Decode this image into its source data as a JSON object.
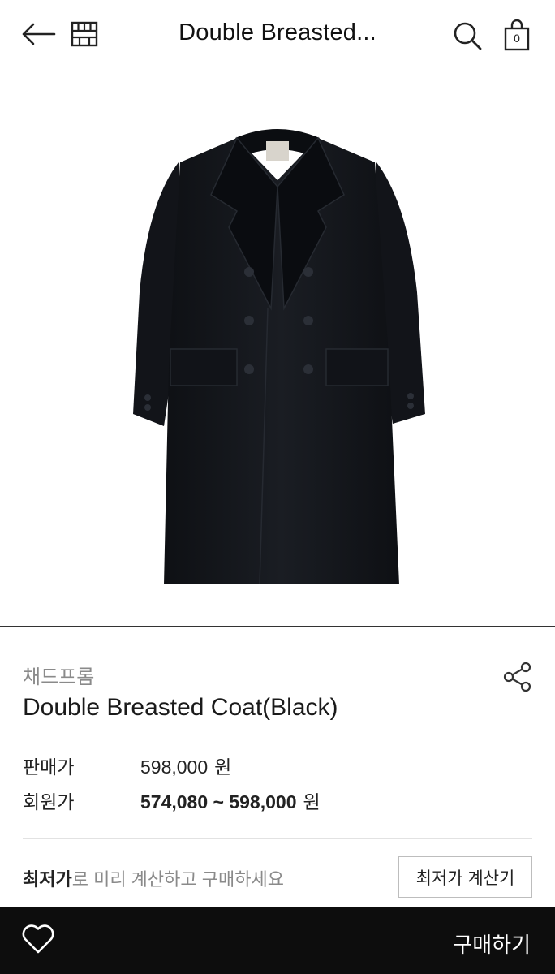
{
  "header": {
    "title": "Double Breasted...",
    "cart_count": "0",
    "icons": [
      "back-arrow-icon",
      "store-icon",
      "search-icon",
      "shopping-bag-icon"
    ]
  },
  "product": {
    "brand": "채드프롬",
    "name": "Double Breasted Coat(Black)",
    "image_desc_icon": "black-double-breasted-coat-image"
  },
  "prices": {
    "sale_label": "판매가",
    "sale_value": "598,000",
    "sale_unit": "원",
    "member_label": "회원가",
    "member_value": "574,080 ~ 598,000",
    "member_unit": "원"
  },
  "lowest": {
    "bold": "최저가",
    "rest": "로 미리 계산하고 구매하세요",
    "button_label": "최저가 계산기"
  },
  "bottom": {
    "buy_label": "구매하기",
    "heart_icon": "heart-icon"
  },
  "colors": {
    "bottom_bar": "#0d0d0d",
    "coat": "#14171c"
  }
}
